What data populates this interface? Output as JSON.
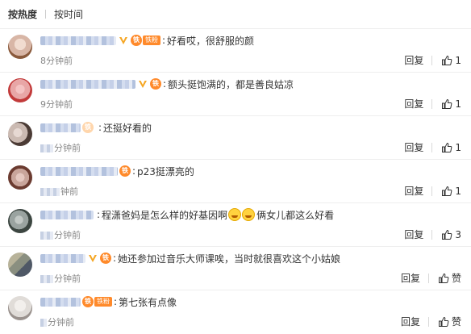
{
  "sort": {
    "hot": "按热度",
    "time": "按时间"
  },
  "actions": {
    "reply": "回复"
  },
  "colors": {
    "fan_badge": "#ff8a2b",
    "verify_v": "#f5a623",
    "link_name": "#9aaed3"
  },
  "comments": [
    {
      "text": "好看哎，很舒服的颜",
      "time": "8分钟前",
      "like": "1",
      "avatar": "#d8b6a6",
      "avatar2": "#8a5a3c"
    },
    {
      "text": "额头挺饱满的，都是善良姑凉",
      "time": "9分钟前",
      "like": "1",
      "avatar": "#e8a6a6",
      "avatar2": "#c23a3a"
    },
    {
      "text": "还挺好看的",
      "time": "分钟前",
      "like": "1",
      "avatar": "#cbbab2",
      "avatar2": "#4b3b35"
    },
    {
      "text": "p23挺漂亮的",
      "time": "钟前",
      "like": "1",
      "avatar": "#c9a59b",
      "avatar2": "#6b3b30"
    },
    {
      "text": "程潇爸妈是怎么样的好基因啊",
      "text2": "俩女儿都这么好看",
      "time": "分钟前",
      "like": "3",
      "avatar": "#9aa3a0",
      "avatar2": "#3c4641"
    },
    {
      "text": "她还参加过音乐大师课唉，当时就很喜欢这个小姑娘",
      "time": "分钟前",
      "like": "赞",
      "avatar": "#b8b39a",
      "avatar2": "#4f5866"
    },
    {
      "text": "第七张有点像",
      "time": "分钟前",
      "like": "赞",
      "avatar": "#e0dcd8",
      "avatar2": "#9a928e"
    }
  ]
}
